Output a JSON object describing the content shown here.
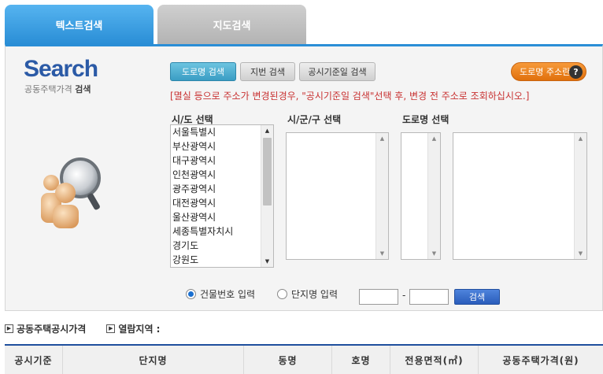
{
  "tabs": {
    "text_search": "텍스트검색",
    "map_search": "지도검색"
  },
  "logo": {
    "title": "Search",
    "subtitle_prefix": "공동주택가격",
    "subtitle_bold": "검색"
  },
  "modes": {
    "road": "도로명 검색",
    "jibun": "지번 검색",
    "notice_date": "공시기준일 검색"
  },
  "road_help": {
    "label": "도로명 주소란",
    "icon": "?"
  },
  "notice": "[멸실 등으로 주소가 변경된경우, \"공시기준일 검색\"선택 후, 변경 전 주소로 조회하십시오.]",
  "columns": {
    "sido": "시/도 선택",
    "sigungu": "시/군/구 선택",
    "road": "도로명 선택"
  },
  "sido_list": [
    "서울특별시",
    "부산광역시",
    "대구광역시",
    "인천광역시",
    "광주광역시",
    "대전광역시",
    "울산광역시",
    "세종특별자치시",
    "경기도",
    "강원도"
  ],
  "radios": {
    "building": "건물번호 입력",
    "complex": "단지명 입력",
    "selected": "building"
  },
  "inputs": {
    "from": "",
    "to": ""
  },
  "search_button": "검색",
  "info": {
    "price_link": "공동주택공시가격",
    "area_label": "열람지역 :"
  },
  "table_headers": [
    "공시기준",
    "단지명",
    "동명",
    "호명",
    "전용면적(㎡)",
    "공동주택가격(원)"
  ],
  "colors": {
    "accent": "#2a8ed6",
    "notice": "#c83232",
    "help": "#e0700c",
    "search_btn": "#2a5dbb"
  }
}
